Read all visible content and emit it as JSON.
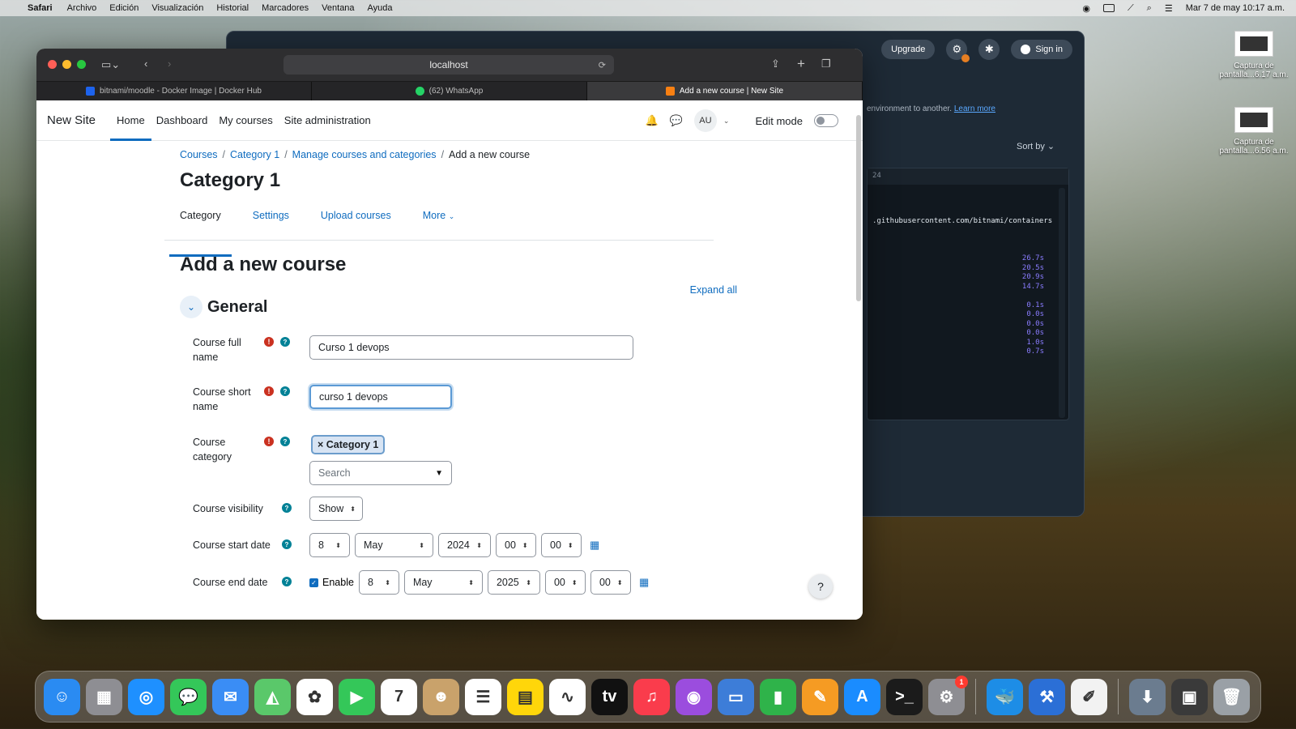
{
  "menubar": {
    "app": "Safari",
    "items": [
      "Archivo",
      "Edición",
      "Visualización",
      "Historial",
      "Marcadores",
      "Ventana",
      "Ayuda"
    ],
    "datetime": "Mar 7 de may  10:17 a.m."
  },
  "desktop": {
    "files": [
      {
        "label": "Captura de pantalla...6.17 a.m."
      },
      {
        "label": "Captura de pantalla...6.56 a.m."
      }
    ]
  },
  "docker": {
    "upgrade": "Upgrade",
    "signin": "Sign in",
    "env_text": "environment to another.",
    "learn_more": "Learn more",
    "sort_by": "Sort by",
    "term_header": "24",
    "term_url": ".githubusercontent.com/bitnami/containers",
    "times": [
      "26.7s",
      "20.5s",
      "20.9s",
      "14.7s",
      "",
      "0.1s",
      "0.0s",
      "0.0s",
      "0.0s",
      "1.0s",
      "0.7s"
    ]
  },
  "browser": {
    "address": "localhost",
    "tabs": [
      {
        "title": "bitnami/moodle - Docker Image | Docker Hub",
        "color": "#1d63ed"
      },
      {
        "title": "(62) WhatsApp",
        "color": "#25d366"
      },
      {
        "title": "Add a new course | New Site",
        "color": "#f98012"
      }
    ]
  },
  "moodle": {
    "site_name": "New Site",
    "nav": [
      "Home",
      "Dashboard",
      "My courses",
      "Site administration"
    ],
    "user_initials": "AU",
    "edit_mode": "Edit mode",
    "breadcrumb": [
      "Courses",
      "Category 1",
      "Manage courses and categories",
      "Add a new course"
    ],
    "category_title": "Category 1",
    "tabs": [
      "Category",
      "Settings",
      "Upload courses",
      "More"
    ],
    "form_title": "Add a new course",
    "expand_all": "Expand all",
    "section": "General",
    "fields": {
      "fullname_label": "Course full name",
      "fullname_value": "Curso 1 devops",
      "shortname_label": "Course short name",
      "shortname_value": "curso 1 devops",
      "category_label": "Course category",
      "category_chip": "× Category 1",
      "category_search": "Search",
      "visibility_label": "Course visibility",
      "visibility_value": "Show",
      "start_label": "Course start date",
      "start_day": "8",
      "start_month": "May",
      "start_year": "2024",
      "start_hour": "00",
      "start_min": "00",
      "end_label": "Course end date",
      "end_enable": "Enable",
      "end_day": "8",
      "end_month": "May",
      "end_year": "2025",
      "end_hour": "00",
      "end_min": "00"
    },
    "help_button": "?"
  },
  "dock": {
    "apps": [
      {
        "name": "finder",
        "color": "#2a8bf2",
        "glyph": "☺"
      },
      {
        "name": "launchpad",
        "color": "#8e8e93",
        "glyph": "▦"
      },
      {
        "name": "safari",
        "color": "#1e90ff",
        "glyph": "◎"
      },
      {
        "name": "messages",
        "color": "#34c759",
        "glyph": "💬"
      },
      {
        "name": "mail",
        "color": "#3a8df5",
        "glyph": "✉"
      },
      {
        "name": "maps",
        "color": "#5ac86a",
        "glyph": "◭"
      },
      {
        "name": "photos",
        "color": "#ffffff",
        "glyph": "✿"
      },
      {
        "name": "facetime",
        "color": "#34c759",
        "glyph": "▶"
      },
      {
        "name": "calendar",
        "color": "#ffffff",
        "glyph": "7"
      },
      {
        "name": "contacts",
        "color": "#c9a26b",
        "glyph": "☻"
      },
      {
        "name": "reminders",
        "color": "#ffffff",
        "glyph": "☰"
      },
      {
        "name": "notes",
        "color": "#ffd60a",
        "glyph": "▤"
      },
      {
        "name": "freeform",
        "color": "#ffffff",
        "glyph": "∿"
      },
      {
        "name": "tv",
        "color": "#111111",
        "glyph": "tv"
      },
      {
        "name": "music",
        "color": "#fa3c4c",
        "glyph": "♫"
      },
      {
        "name": "podcasts",
        "color": "#9b4dde",
        "glyph": "◉"
      },
      {
        "name": "keynote",
        "color": "#3d7dd8",
        "glyph": "▭"
      },
      {
        "name": "numbers",
        "color": "#2fb34a",
        "glyph": "▮"
      },
      {
        "name": "pages",
        "color": "#f59b23",
        "glyph": "✎"
      },
      {
        "name": "app-store",
        "color": "#1a8cff",
        "glyph": "A"
      },
      {
        "name": "terminal",
        "color": "#1b1b1b",
        "glyph": ">_"
      },
      {
        "name": "system-settings",
        "color": "#8e8e93",
        "glyph": "⚙",
        "badge": "1"
      }
    ],
    "extra": [
      {
        "name": "docker",
        "color": "#1d8de6",
        "glyph": "🐳"
      },
      {
        "name": "xcode",
        "color": "#2b6fd6",
        "glyph": "⚒"
      },
      {
        "name": "textedit",
        "color": "#f2f2f2",
        "glyph": "✐"
      }
    ],
    "right": [
      {
        "name": "downloads",
        "color": "#6b7c8f",
        "glyph": "⬇"
      },
      {
        "name": "screenshots",
        "color": "#3a3a3a",
        "glyph": "▣"
      },
      {
        "name": "trash",
        "color": "#9aa0a6",
        "glyph": "🗑"
      }
    ]
  }
}
